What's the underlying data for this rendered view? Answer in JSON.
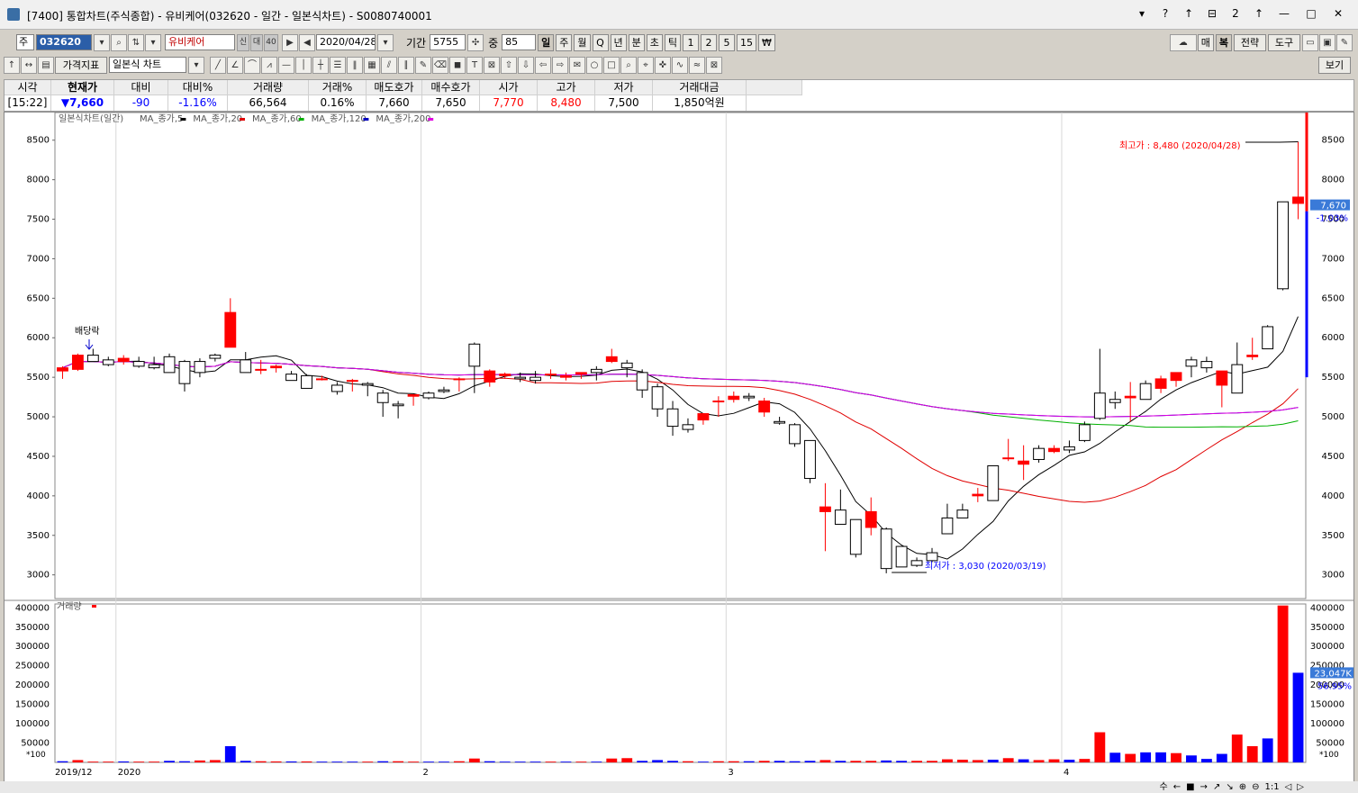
{
  "window": {
    "title": "[7400] 통합차트(주식종합) - 유비케어(032620 - 일간 - 일본식차트) - S0080740001",
    "title_buttons": [
      "▾",
      "?",
      "↑",
      "⊟",
      "2",
      "↑"
    ],
    "window_buttons": [
      "—",
      "□",
      "✕"
    ]
  },
  "toolbar1": {
    "market": "주",
    "code": "032620",
    "name": "유비케어",
    "badges": [
      "신",
      "대",
      "40"
    ],
    "date": "2020/04/28",
    "period_label": "기간",
    "period_value": "5755",
    "count_label": "중",
    "count_value": "85",
    "intervals": [
      "일",
      "주",
      "월",
      "Q",
      "년",
      "분",
      "초",
      "틱",
      "1",
      "2",
      "5",
      "15",
      "₩"
    ],
    "right_buttons": [
      "매",
      "복",
      "전략",
      "도구"
    ]
  },
  "toolbar2": {
    "indicator_button": "가격지표",
    "chart_type": "일본식 차트",
    "view_button": "보기"
  },
  "quote": {
    "headers": [
      "시각",
      "현재가",
      "대비",
      "대비%",
      "거래량",
      "거래%",
      "매도호가",
      "매수호가",
      "시가",
      "고가",
      "저가",
      "거래대금"
    ],
    "values": [
      "[15:22]",
      "▼7,660",
      "-90",
      "-1.16%",
      "66,564",
      "0.16%",
      "7,660",
      "7,650",
      "7,770",
      "8,480",
      "7,500",
      "1,850억원"
    ]
  },
  "legend": {
    "chart_label": "일본식차트(일간)",
    "ma": [
      {
        "label": "MA_종가,5",
        "color": "#000000"
      },
      {
        "label": "MA_종가,20",
        "color": "#e00000"
      },
      {
        "label": "MA_종가,60",
        "color": "#00b000"
      },
      {
        "label": "MA_종가,120",
        "color": "#0000c0"
      },
      {
        "label": "MA_종가,200",
        "color": "#e000e0"
      }
    ],
    "volume_label": "거래량"
  },
  "annotations": {
    "dividend": "배당락",
    "high": "최고가 : 8,480 (2020/04/28)",
    "low": "최저가 : 3,030 (2020/03/19)",
    "price_tag": "7,670",
    "price_pct": "-1.03%",
    "vol_tag": "23,047K",
    "vol_pct": "56.95%",
    "scale_tag": "*100"
  },
  "x_labels": [
    "2019/12",
    "2020",
    "2",
    "3",
    "4"
  ],
  "bottom_controls": [
    "수",
    "←",
    "■",
    "→",
    "↗",
    "↘",
    "⊕",
    "⊖",
    "1:1",
    "◁",
    "▷"
  ],
  "colors": {
    "up": "#ff0000",
    "down": "#0000ff",
    "ma5": "#000000",
    "ma20": "#e00000",
    "ma60": "#00b000",
    "ma120": "#0000c0",
    "ma200": "#e000e0"
  },
  "chart_data": [
    {
      "type": "candlestick",
      "title": "일본식차트(일간)",
      "ylim": [
        2700,
        8850
      ],
      "yticks": [
        3000,
        3500,
        4000,
        4500,
        5000,
        5500,
        6000,
        6500,
        7000,
        7500,
        8000,
        8500
      ],
      "ohlc": [
        [
          5580,
          5640,
          5480,
          5620
        ],
        [
          5600,
          5800,
          5580,
          5780
        ],
        [
          5780,
          5860,
          5700,
          5700
        ],
        [
          5720,
          5760,
          5640,
          5660
        ],
        [
          5700,
          5780,
          5660,
          5740
        ],
        [
          5700,
          5760,
          5620,
          5640
        ],
        [
          5660,
          5760,
          5600,
          5620
        ],
        [
          5760,
          5800,
          5560,
          5560
        ],
        [
          5700,
          5720,
          5320,
          5420
        ],
        [
          5700,
          5740,
          5500,
          5560
        ],
        [
          5780,
          5800,
          5700,
          5740
        ],
        [
          5880,
          6500,
          5880,
          6320
        ],
        [
          5720,
          5820,
          5560,
          5560
        ],
        [
          5600,
          5720,
          5540,
          5600
        ],
        [
          5620,
          5660,
          5560,
          5640
        ],
        [
          5540,
          5580,
          5480,
          5460
        ],
        [
          5520,
          5540,
          5360,
          5360
        ],
        [
          5480,
          5520,
          5460,
          5480
        ],
        [
          5400,
          5440,
          5280,
          5320
        ],
        [
          5460,
          5480,
          5320,
          5460
        ],
        [
          5420,
          5440,
          5260,
          5400
        ],
        [
          5300,
          5340,
          5000,
          5180
        ],
        [
          5160,
          5200,
          4980,
          5140
        ],
        [
          5260,
          5280,
          5140,
          5280
        ],
        [
          5300,
          5320,
          5220,
          5240
        ],
        [
          5340,
          5380,
          5300,
          5320
        ],
        [
          5480,
          5500,
          5320,
          5480
        ],
        [
          5920,
          5940,
          5300,
          5640
        ],
        [
          5440,
          5600,
          5380,
          5580
        ],
        [
          5520,
          5560,
          5480,
          5540
        ],
        [
          5500,
          5560,
          5440,
          5480
        ],
        [
          5500,
          5580,
          5420,
          5460
        ],
        [
          5540,
          5600,
          5480,
          5540
        ],
        [
          5500,
          5560,
          5460,
          5520
        ],
        [
          5540,
          5560,
          5480,
          5560
        ],
        [
          5600,
          5640,
          5460,
          5560
        ],
        [
          5700,
          5860,
          5680,
          5760
        ],
        [
          5680,
          5720,
          5500,
          5620
        ],
        [
          5560,
          5600,
          5240,
          5340
        ],
        [
          5380,
          5420,
          5000,
          5100
        ],
        [
          5100,
          5200,
          4760,
          4880
        ],
        [
          4900,
          4980,
          4800,
          4840
        ],
        [
          4960,
          5040,
          4900,
          5040
        ],
        [
          5200,
          5260,
          5000,
          5200
        ],
        [
          5220,
          5320,
          5180,
          5260
        ],
        [
          5260,
          5300,
          5200,
          5240
        ],
        [
          5060,
          5240,
          5000,
          5200
        ],
        [
          4940,
          5000,
          4900,
          4920
        ],
        [
          4900,
          4920,
          4620,
          4660
        ],
        [
          4700,
          4700,
          4160,
          4220
        ],
        [
          3800,
          4160,
          3300,
          3860
        ],
        [
          3820,
          4080,
          3640,
          3640
        ],
        [
          3700,
          3700,
          3220,
          3260
        ],
        [
          3600,
          3980,
          3500,
          3800
        ],
        [
          3580,
          3600,
          3020,
          3080
        ],
        [
          3360,
          3360,
          3100,
          3100
        ],
        [
          3180,
          3220,
          3100,
          3120
        ],
        [
          3280,
          3340,
          3160,
          3180
        ],
        [
          3720,
          3900,
          3520,
          3520
        ],
        [
          3820,
          3900,
          3720,
          3720
        ],
        [
          4000,
          4100,
          3920,
          4020
        ],
        [
          4380,
          4380,
          3940,
          3940
        ],
        [
          4480,
          4720,
          4440,
          4480
        ],
        [
          4400,
          4640,
          4200,
          4440
        ],
        [
          4600,
          4640,
          4420,
          4460
        ],
        [
          4560,
          4640,
          4540,
          4600
        ],
        [
          4620,
          4700,
          4540,
          4580
        ],
        [
          4900,
          4940,
          4680,
          4700
        ],
        [
          5300,
          5860,
          4960,
          4980
        ],
        [
          5220,
          5320,
          5100,
          5180
        ],
        [
          5240,
          5440,
          4940,
          5260
        ],
        [
          5420,
          5460,
          5240,
          5220
        ],
        [
          5360,
          5520,
          5300,
          5480
        ],
        [
          5460,
          5560,
          5380,
          5560
        ],
        [
          5720,
          5760,
          5500,
          5640
        ],
        [
          5700,
          5760,
          5560,
          5620
        ],
        [
          5400,
          5520,
          5120,
          5580
        ],
        [
          5660,
          5940,
          5320,
          5300
        ],
        [
          5760,
          6000,
          5720,
          5780
        ],
        [
          6140,
          6160,
          5920,
          5860
        ],
        [
          7720,
          7720,
          6600,
          6620
        ],
        [
          7700,
          8480,
          7500,
          7780
        ]
      ]
    },
    {
      "type": "bar",
      "title": "거래량",
      "ylim": [
        0,
        410000
      ],
      "yticks": [
        50000,
        100000,
        150000,
        200000,
        250000,
        300000,
        350000,
        400000
      ],
      "values": [
        3000,
        6000,
        2000,
        2000,
        2500,
        2000,
        2000,
        4000,
        3000,
        5000,
        6000,
        42000,
        4000,
        3000,
        2500,
        2500,
        2500,
        2000,
        2000,
        2000,
        2000,
        3000,
        3000,
        2000,
        2000,
        2000,
        3000,
        10000,
        3000,
        2000,
        2000,
        2000,
        2000,
        2000,
        2000,
        2000,
        10000,
        11000,
        4000,
        6000,
        4000,
        3000,
        2000,
        3000,
        3000,
        3000,
        4000,
        4000,
        3000,
        4000,
        6000,
        4000,
        4000,
        4000,
        5000,
        4000,
        4000,
        4000,
        8000,
        7000,
        6000,
        7000,
        11000,
        8000,
        6000,
        8000,
        7000,
        9000,
        78000,
        25000,
        22000,
        26000,
        26000,
        24000,
        18000,
        9000,
        22000,
        72000,
        42000,
        62000,
        406000,
        232000
      ],
      "up": [
        0,
        1,
        1,
        1,
        0,
        1,
        1,
        0,
        0,
        1,
        1,
        0,
        0,
        1,
        1,
        0,
        1,
        0,
        0,
        0,
        1,
        0,
        1,
        1,
        0,
        0,
        1,
        1,
        0,
        0,
        0,
        0,
        1,
        0,
        1,
        0,
        1,
        1,
        0,
        0,
        0,
        1,
        0,
        1,
        1,
        0,
        1,
        0,
        0,
        0,
        1,
        0,
        1,
        1,
        0,
        0,
        1,
        1,
        1,
        1,
        1,
        0,
        1,
        0,
        1,
        1,
        0,
        1,
        1,
        0,
        1,
        0,
        0,
        1,
        0,
        0,
        0,
        1,
        1,
        0,
        1,
        0
      ]
    }
  ]
}
